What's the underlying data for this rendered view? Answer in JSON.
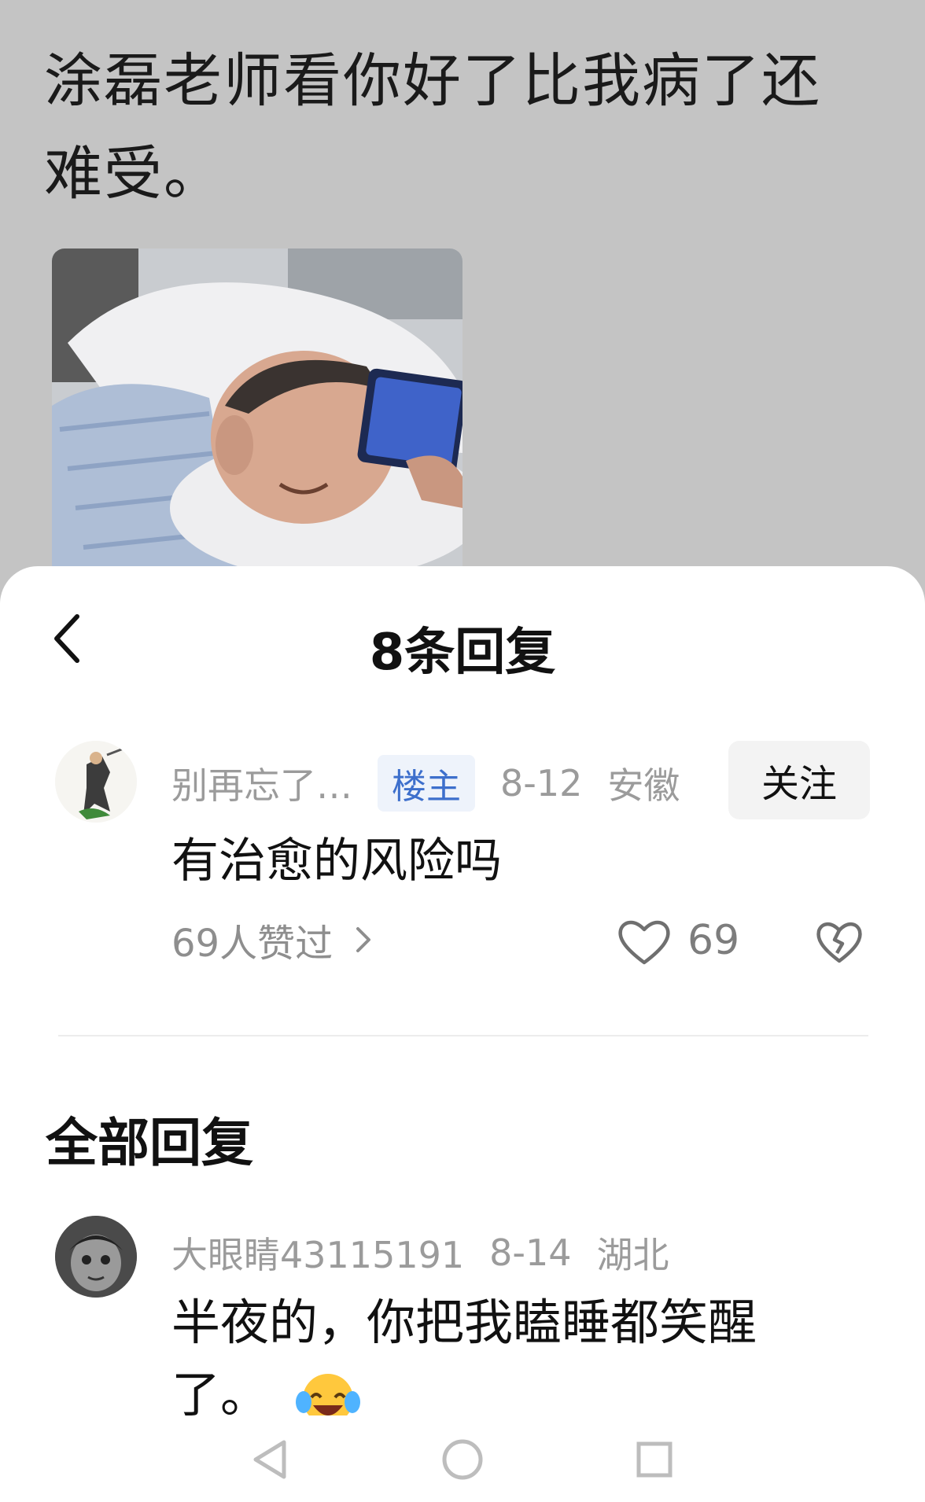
{
  "post": {
    "title": "涂磊老师看你好了比我病了还难受。"
  },
  "sheet": {
    "title": "8条回复"
  },
  "main_comment": {
    "username": "别再忘了…",
    "badge": "楼主",
    "date": "8-12",
    "location": "安徽",
    "follow_label": "关注",
    "text": "有治愈的风险吗",
    "likes_summary": "69人赞过",
    "like_count": "69"
  },
  "section": {
    "title": "全部回复"
  },
  "reply": {
    "username": "大眼睛43115191",
    "date": "8-14",
    "location": "湖北",
    "text": "半夜的，你把我瞌睡都笑醒了。"
  },
  "icons": {
    "back": "chevron-left-icon",
    "like": "heart-outline-icon",
    "dislike": "broken-heart-icon",
    "reply_emoji": "laughing-tears-emoji",
    "nav_back": "triangle-back-icon",
    "nav_home": "circle-home-icon",
    "nav_recent": "square-recent-icon"
  }
}
